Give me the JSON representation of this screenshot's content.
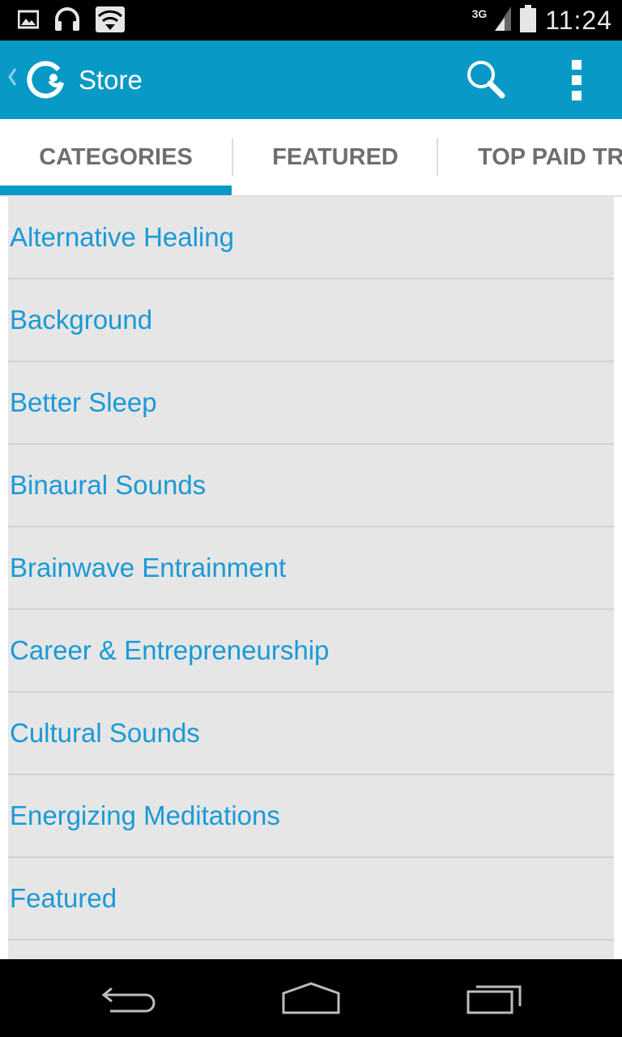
{
  "status_bar": {
    "network": "3G",
    "time": "11:24",
    "icons": [
      "gallery-icon",
      "headphones-icon",
      "wifi-icon",
      "signal-icon",
      "battery-icon"
    ]
  },
  "action_bar": {
    "title": "Store",
    "icons": [
      "up-chevron-icon",
      "app-logo-icon",
      "search-icon",
      "overflow-menu-icon"
    ]
  },
  "tabs": [
    {
      "label": "CATEGORIES",
      "selected": true
    },
    {
      "label": "FEATURED",
      "selected": false
    },
    {
      "label": "TOP PAID TRACKS",
      "selected": false
    }
  ],
  "categories": [
    "Alternative Healing",
    "Background",
    "Better Sleep",
    "Binaural Sounds",
    "Brainwave Entrainment",
    "Career & Entrepreneurship",
    "Cultural Sounds",
    "Energizing Meditations",
    "Featured"
  ],
  "colors": {
    "accent": "#0899c6",
    "list_text": "#1a9ad6",
    "list_background": "#e6e6e6"
  },
  "nav_bar": {
    "icons": [
      "back-icon",
      "home-icon",
      "recent-apps-icon"
    ]
  }
}
